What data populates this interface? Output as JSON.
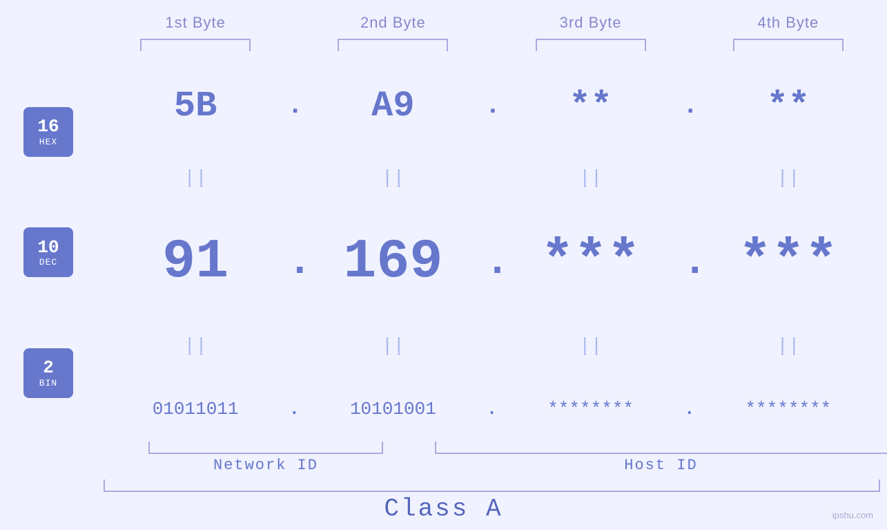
{
  "header": {
    "bytes": [
      {
        "label": "1st Byte"
      },
      {
        "label": "2nd Byte"
      },
      {
        "label": "3rd Byte"
      },
      {
        "label": "4th Byte"
      }
    ]
  },
  "badges": [
    {
      "number": "16",
      "unit": "HEX"
    },
    {
      "number": "10",
      "unit": "DEC"
    },
    {
      "number": "2",
      "unit": "BIN"
    }
  ],
  "hex_row": {
    "b1": "5B",
    "b2": "A9",
    "b3": "**",
    "b4": "**"
  },
  "dec_row": {
    "b1": "91",
    "b2": "169",
    "b3": "***",
    "b4": "***"
  },
  "bin_row": {
    "b1": "01011011",
    "b2": "10101001",
    "b3": "********",
    "b4": "********"
  },
  "labels": {
    "network_id": "Network ID",
    "host_id": "Host ID",
    "class": "Class A"
  },
  "watermark": "ipshu.com"
}
